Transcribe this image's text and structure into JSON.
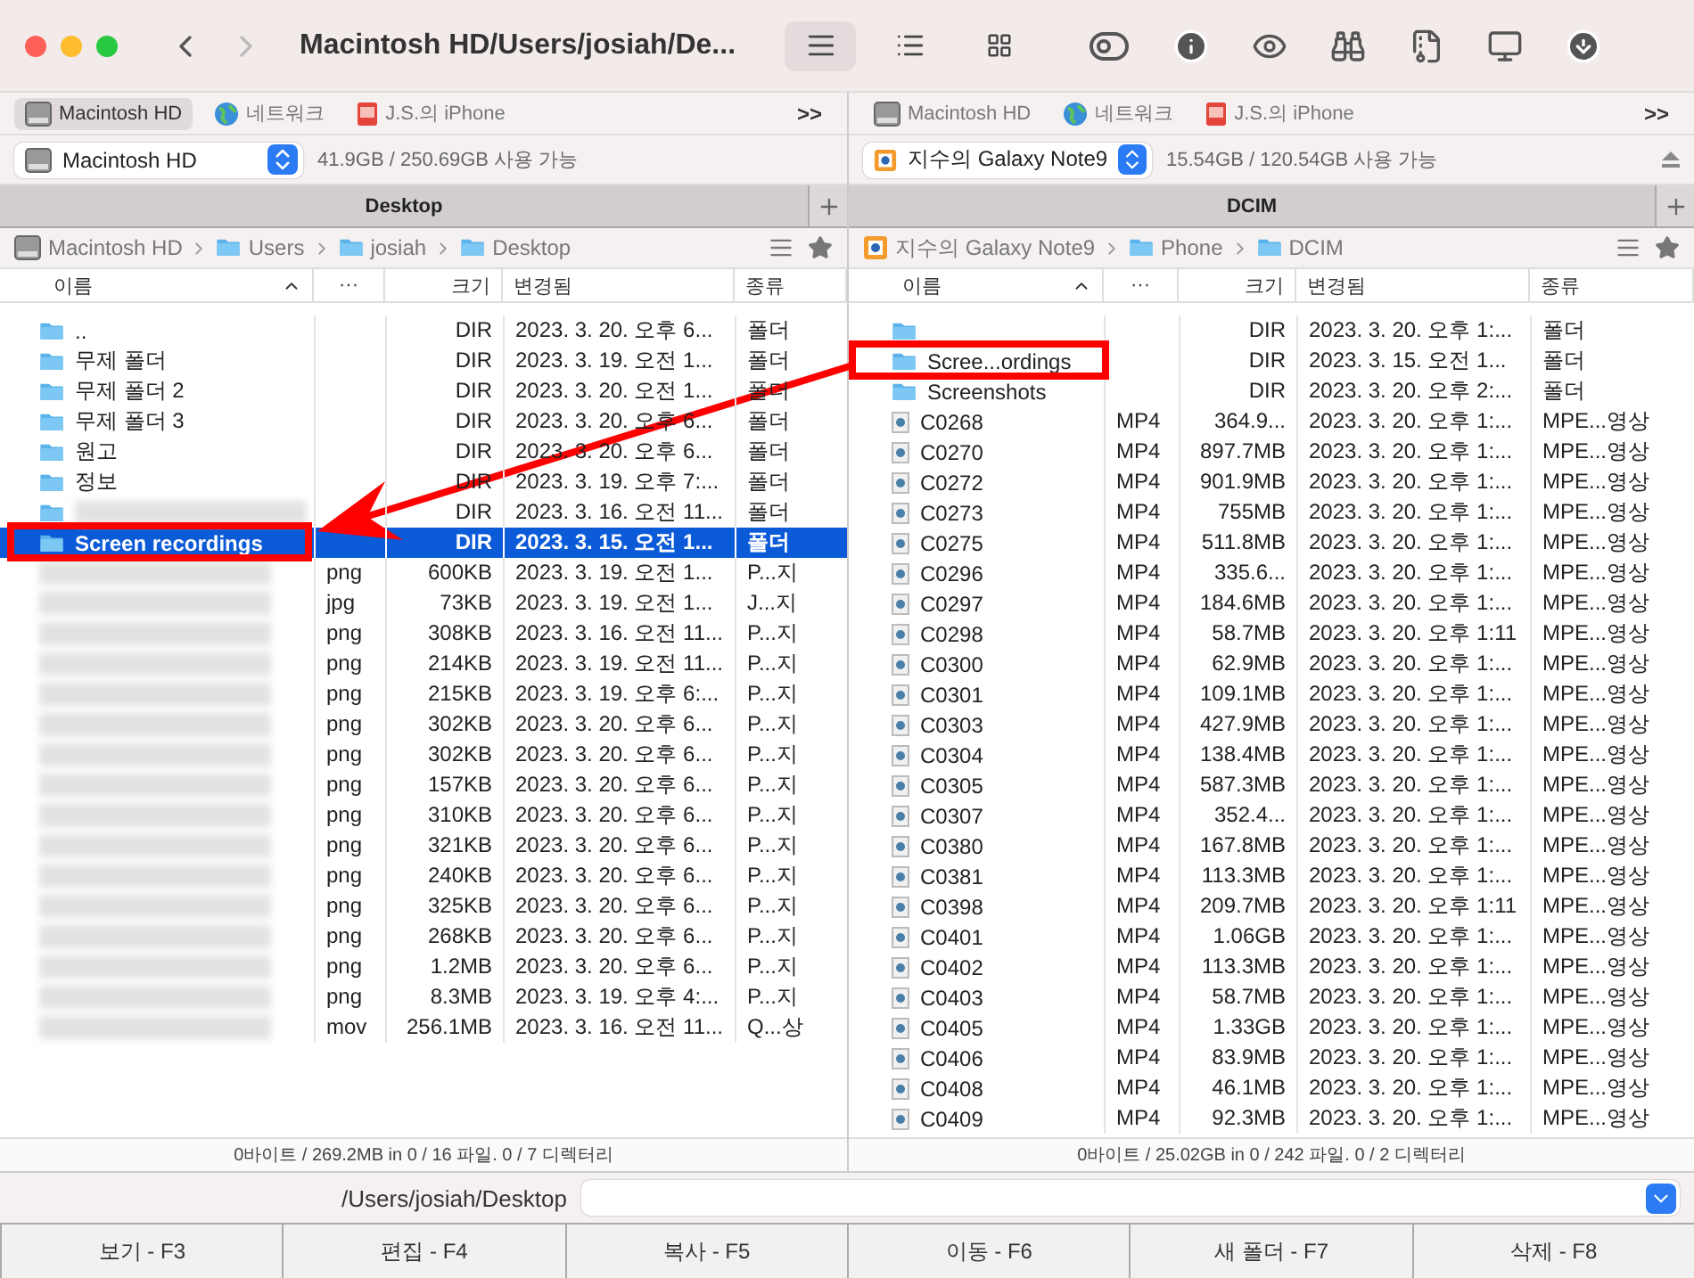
{
  "window": {
    "title": "Macintosh HD/Users/josiah/De..."
  },
  "toolbar": {
    "view_modes": [
      {
        "kind": "list",
        "selected": true
      },
      {
        "kind": "details",
        "selected": false
      },
      {
        "kind": "grid",
        "selected": false
      }
    ]
  },
  "panes": [
    {
      "favorites": [
        {
          "label": "Macintosh HD",
          "kind": "disk",
          "selected": true
        },
        {
          "label": "네트워크",
          "kind": "network",
          "selected": false
        },
        {
          "label": "J.S.의 iPhone",
          "kind": "phone",
          "selected": false
        }
      ],
      "overflow": ">>",
      "drive": {
        "name": "Macintosh HD",
        "kind": "disk"
      },
      "free_space": "41.9GB / 250.69GB 사용 가능",
      "ejectable": false,
      "tab": "Desktop",
      "breadcrumb": [
        {
          "label": "Macintosh HD",
          "kind": "disk"
        },
        {
          "label": "Users",
          "kind": "folder"
        },
        {
          "label": "josiah",
          "kind": "folder"
        },
        {
          "label": "Desktop",
          "kind": "folder"
        }
      ],
      "columns": [
        "이름",
        "···",
        "크기",
        "변경됨",
        "종류"
      ],
      "rows": [
        {
          "name": "..",
          "kind": "folder",
          "size": "DIR",
          "date": "2023. 3. 20. 오후 6...",
          "type": "폴더",
          "blurred": false,
          "selected": false,
          "marked": false
        },
        {
          "name": "무제 폴더",
          "kind": "folder",
          "size": "DIR",
          "date": "2023. 3. 19. 오전 1...",
          "type": "폴더",
          "blurred": false,
          "selected": false,
          "marked": false
        },
        {
          "name": "무제 폴더 2",
          "kind": "folder",
          "size": "DIR",
          "date": "2023. 3. 20. 오전 1...",
          "type": "폴더",
          "blurred": false,
          "selected": false,
          "marked": false
        },
        {
          "name": "무제 폴더 3",
          "kind": "folder",
          "size": "DIR",
          "date": "2023. 3. 20. 오후 6...",
          "type": "폴더",
          "blurred": false,
          "selected": false,
          "marked": false
        },
        {
          "name": "원고",
          "kind": "folder",
          "size": "DIR",
          "date": "2023. 3. 20. 오후 6...",
          "type": "폴더",
          "blurred": false,
          "selected": false,
          "marked": false
        },
        {
          "name": "정보",
          "kind": "folder",
          "size": "DIR",
          "date": "2023. 3. 19. 오후 7:...",
          "type": "폴더",
          "blurred": false,
          "selected": false,
          "marked": false
        },
        {
          "kind": "folder",
          "size": "DIR",
          "date": "2023. 3. 16. 오전 11...",
          "type": "폴더",
          "blurred": true,
          "selected": false,
          "marked": false
        },
        {
          "name": "Screen recordings",
          "kind": "folder",
          "size": "DIR",
          "date": "2023. 3. 15. 오전 1...",
          "type": "폴더",
          "blurred": false,
          "selected": true,
          "marked": true
        },
        {
          "kind": "file",
          "ext": "png",
          "size": "600KB",
          "date": "2023. 3. 19. 오전 1...",
          "type": "P...지",
          "blurred": true,
          "selected": false,
          "marked": false
        },
        {
          "kind": "file",
          "ext": "jpg",
          "size": "73KB",
          "date": "2023. 3. 19. 오전 1...",
          "type": "J...지",
          "blurred": true,
          "selected": false,
          "marked": false
        },
        {
          "kind": "file",
          "ext": "png",
          "size": "308KB",
          "date": "2023. 3. 16. 오전 11...",
          "type": "P...지",
          "blurred": true,
          "selected": false,
          "marked": false
        },
        {
          "kind": "file",
          "ext": "png",
          "size": "214KB",
          "date": "2023. 3. 19. 오전 11...",
          "type": "P...지",
          "blurred": true,
          "selected": false,
          "marked": false
        },
        {
          "kind": "file",
          "ext": "png",
          "size": "215KB",
          "date": "2023. 3. 19. 오후 6:...",
          "type": "P...지",
          "blurred": true,
          "selected": false,
          "marked": false
        },
        {
          "kind": "file",
          "ext": "png",
          "size": "302KB",
          "date": "2023. 3. 20. 오후 6...",
          "type": "P...지",
          "blurred": true,
          "selected": false,
          "marked": false
        },
        {
          "kind": "file",
          "ext": "png",
          "size": "302KB",
          "date": "2023. 3. 20. 오후 6...",
          "type": "P...지",
          "blurred": true,
          "selected": false,
          "marked": false
        },
        {
          "kind": "file",
          "ext": "png",
          "size": "157KB",
          "date": "2023. 3. 20. 오후 6...",
          "type": "P...지",
          "blurred": true,
          "selected": false,
          "marked": false
        },
        {
          "kind": "file",
          "ext": "png",
          "size": "310KB",
          "date": "2023. 3. 20. 오후 6...",
          "type": "P...지",
          "blurred": true,
          "selected": false,
          "marked": false
        },
        {
          "kind": "file",
          "ext": "png",
          "size": "321KB",
          "date": "2023. 3. 20. 오후 6...",
          "type": "P...지",
          "blurred": true,
          "selected": false,
          "marked": false
        },
        {
          "kind": "file",
          "ext": "png",
          "size": "240KB",
          "date": "2023. 3. 20. 오후 6...",
          "type": "P...지",
          "blurred": true,
          "selected": false,
          "marked": false
        },
        {
          "kind": "file",
          "ext": "png",
          "size": "325KB",
          "date": "2023. 3. 20. 오후 6...",
          "type": "P...지",
          "blurred": true,
          "selected": false,
          "marked": false
        },
        {
          "kind": "file",
          "ext": "png",
          "size": "268KB",
          "date": "2023. 3. 20. 오후 6...",
          "type": "P...지",
          "blurred": true,
          "selected": false,
          "marked": false
        },
        {
          "kind": "file",
          "ext": "png",
          "size": "1.2MB",
          "date": "2023. 3. 20. 오후 6...",
          "type": "P...지",
          "blurred": true,
          "selected": false,
          "marked": false
        },
        {
          "kind": "file",
          "ext": "png",
          "size": "8.3MB",
          "date": "2023. 3. 19. 오후 4:...",
          "type": "P...지",
          "blurred": true,
          "selected": false,
          "marked": false
        },
        {
          "kind": "file",
          "ext": "mov",
          "size": "256.1MB",
          "date": "2023. 3. 16. 오전 11...",
          "type": "Q...상",
          "blurred": true,
          "selected": false,
          "marked": false
        }
      ],
      "status": "0바이트 / 269.2MB in 0 / 16 파일. 0 / 7 디렉터리"
    },
    {
      "favorites": [
        {
          "label": "Macintosh HD",
          "kind": "disk",
          "selected": false
        },
        {
          "label": "네트워크",
          "kind": "network",
          "selected": false
        },
        {
          "label": "J.S.의 iPhone",
          "kind": "phone",
          "selected": false
        }
      ],
      "overflow": ">>",
      "drive": {
        "name": "지수의 Galaxy Note9",
        "kind": "android"
      },
      "free_space": "15.54GB / 120.54GB 사용 가능",
      "ejectable": true,
      "tab": "DCIM",
      "breadcrumb": [
        {
          "label": "지수의 Galaxy Note9",
          "kind": "android"
        },
        {
          "label": "Phone",
          "kind": "folder"
        },
        {
          "label": "DCIM",
          "kind": "folder"
        }
      ],
      "columns": [
        "이름",
        "···",
        "크기",
        "변경됨",
        "종류"
      ],
      "rows": [
        {
          "kind": "folder",
          "size": "DIR",
          "date": "2023. 3. 20. 오후 1:...",
          "type": "폴더",
          "blurred": false,
          "selected": false,
          "marked": false
        },
        {
          "name": "Scree...ordings",
          "kind": "folder",
          "size": "DIR",
          "date": "2023. 3. 15. 오전 1...",
          "type": "폴더",
          "blurred": false,
          "selected": false,
          "marked": true
        },
        {
          "name": "Screenshots",
          "kind": "folder",
          "size": "DIR",
          "date": "2023. 3. 20. 오후 2:...",
          "type": "폴더",
          "blurred": false,
          "selected": false,
          "marked": false
        },
        {
          "name": "C0268",
          "kind": "video",
          "ext": "MP4",
          "size": "364.9...",
          "date": "2023. 3. 20. 오후 1:...",
          "type": "MPE...영상",
          "blurred": false,
          "selected": false,
          "marked": false
        },
        {
          "name": "C0270",
          "kind": "video",
          "ext": "MP4",
          "size": "897.7MB",
          "date": "2023. 3. 20. 오후 1:...",
          "type": "MPE...영상",
          "blurred": false,
          "selected": false,
          "marked": false
        },
        {
          "name": "C0272",
          "kind": "video",
          "ext": "MP4",
          "size": "901.9MB",
          "date": "2023. 3. 20. 오후 1:...",
          "type": "MPE...영상",
          "blurred": false,
          "selected": false,
          "marked": false
        },
        {
          "name": "C0273",
          "kind": "video",
          "ext": "MP4",
          "size": "755MB",
          "date": "2023. 3. 20. 오후 1:...",
          "type": "MPE...영상",
          "blurred": false,
          "selected": false,
          "marked": false
        },
        {
          "name": "C0275",
          "kind": "video",
          "ext": "MP4",
          "size": "511.8MB",
          "date": "2023. 3. 20. 오후 1:...",
          "type": "MPE...영상",
          "blurred": false,
          "selected": false,
          "marked": false
        },
        {
          "name": "C0296",
          "kind": "video",
          "ext": "MP4",
          "size": "335.6...",
          "date": "2023. 3. 20. 오후 1:...",
          "type": "MPE...영상",
          "blurred": false,
          "selected": false,
          "marked": false
        },
        {
          "name": "C0297",
          "kind": "video",
          "ext": "MP4",
          "size": "184.6MB",
          "date": "2023. 3. 20. 오후 1:...",
          "type": "MPE...영상",
          "blurred": false,
          "selected": false,
          "marked": false
        },
        {
          "name": "C0298",
          "kind": "video",
          "ext": "MP4",
          "size": "58.7MB",
          "date": "2023. 3. 20. 오후 1:11",
          "type": "MPE...영상",
          "blurred": false,
          "selected": false,
          "marked": false
        },
        {
          "name": "C0300",
          "kind": "video",
          "ext": "MP4",
          "size": "62.9MB",
          "date": "2023. 3. 20. 오후 1:...",
          "type": "MPE...영상",
          "blurred": false,
          "selected": false,
          "marked": false
        },
        {
          "name": "C0301",
          "kind": "video",
          "ext": "MP4",
          "size": "109.1MB",
          "date": "2023. 3. 20. 오후 1:...",
          "type": "MPE...영상",
          "blurred": false,
          "selected": false,
          "marked": false
        },
        {
          "name": "C0303",
          "kind": "video",
          "ext": "MP4",
          "size": "427.9MB",
          "date": "2023. 3. 20. 오후 1:...",
          "type": "MPE...영상",
          "blurred": false,
          "selected": false,
          "marked": false
        },
        {
          "name": "C0304",
          "kind": "video",
          "ext": "MP4",
          "size": "138.4MB",
          "date": "2023. 3. 20. 오후 1:...",
          "type": "MPE...영상",
          "blurred": false,
          "selected": false,
          "marked": false
        },
        {
          "name": "C0305",
          "kind": "video",
          "ext": "MP4",
          "size": "587.3MB",
          "date": "2023. 3. 20. 오후 1:...",
          "type": "MPE...영상",
          "blurred": false,
          "selected": false,
          "marked": false
        },
        {
          "name": "C0307",
          "kind": "video",
          "ext": "MP4",
          "size": "352.4...",
          "date": "2023. 3. 20. 오후 1:...",
          "type": "MPE...영상",
          "blurred": false,
          "selected": false,
          "marked": false
        },
        {
          "name": "C0380",
          "kind": "video",
          "ext": "MP4",
          "size": "167.8MB",
          "date": "2023. 3. 20. 오후 1:...",
          "type": "MPE...영상",
          "blurred": false,
          "selected": false,
          "marked": false
        },
        {
          "name": "C0381",
          "kind": "video",
          "ext": "MP4",
          "size": "113.3MB",
          "date": "2023. 3. 20. 오후 1:...",
          "type": "MPE...영상",
          "blurred": false,
          "selected": false,
          "marked": false
        },
        {
          "name": "C0398",
          "kind": "video",
          "ext": "MP4",
          "size": "209.7MB",
          "date": "2023. 3. 20. 오후 1:11",
          "type": "MPE...영상",
          "blurred": false,
          "selected": false,
          "marked": false
        },
        {
          "name": "C0401",
          "kind": "video",
          "ext": "MP4",
          "size": "1.06GB",
          "date": "2023. 3. 20. 오후 1:...",
          "type": "MPE...영상",
          "blurred": false,
          "selected": false,
          "marked": false
        },
        {
          "name": "C0402",
          "kind": "video",
          "ext": "MP4",
          "size": "113.3MB",
          "date": "2023. 3. 20. 오후 1:...",
          "type": "MPE...영상",
          "blurred": false,
          "selected": false,
          "marked": false
        },
        {
          "name": "C0403",
          "kind": "video",
          "ext": "MP4",
          "size": "58.7MB",
          "date": "2023. 3. 20. 오후 1:...",
          "type": "MPE...영상",
          "blurred": false,
          "selected": false,
          "marked": false
        },
        {
          "name": "C0405",
          "kind": "video",
          "ext": "MP4",
          "size": "1.33GB",
          "date": "2023. 3. 20. 오후 1:...",
          "type": "MPE...영상",
          "blurred": false,
          "selected": false,
          "marked": false
        },
        {
          "name": "C0406",
          "kind": "video",
          "ext": "MP4",
          "size": "83.9MB",
          "date": "2023. 3. 20. 오후 1:...",
          "type": "MPE...영상",
          "blurred": false,
          "selected": false,
          "marked": false
        },
        {
          "name": "C0408",
          "kind": "video",
          "ext": "MP4",
          "size": "46.1MB",
          "date": "2023. 3. 20. 오후 1:...",
          "type": "MPE...영상",
          "blurred": false,
          "selected": false,
          "marked": false
        },
        {
          "name": "C0409",
          "kind": "video",
          "ext": "MP4",
          "size": "92.3MB",
          "date": "2023. 3. 20. 오후 1:...",
          "type": "MPE...영상",
          "blurred": false,
          "selected": false,
          "marked": false
        }
      ],
      "status": "0바이트 / 25.02GB in 0 / 242 파일. 0 / 2 디렉터리"
    }
  ],
  "path_bar": {
    "path": "/Users/josiah/Desktop"
  },
  "function_keys": [
    "보기 - F3",
    "편집 - F4",
    "복사 - F5",
    "이동 - F6",
    "새 폴더 - F7",
    "삭제 - F8"
  ]
}
